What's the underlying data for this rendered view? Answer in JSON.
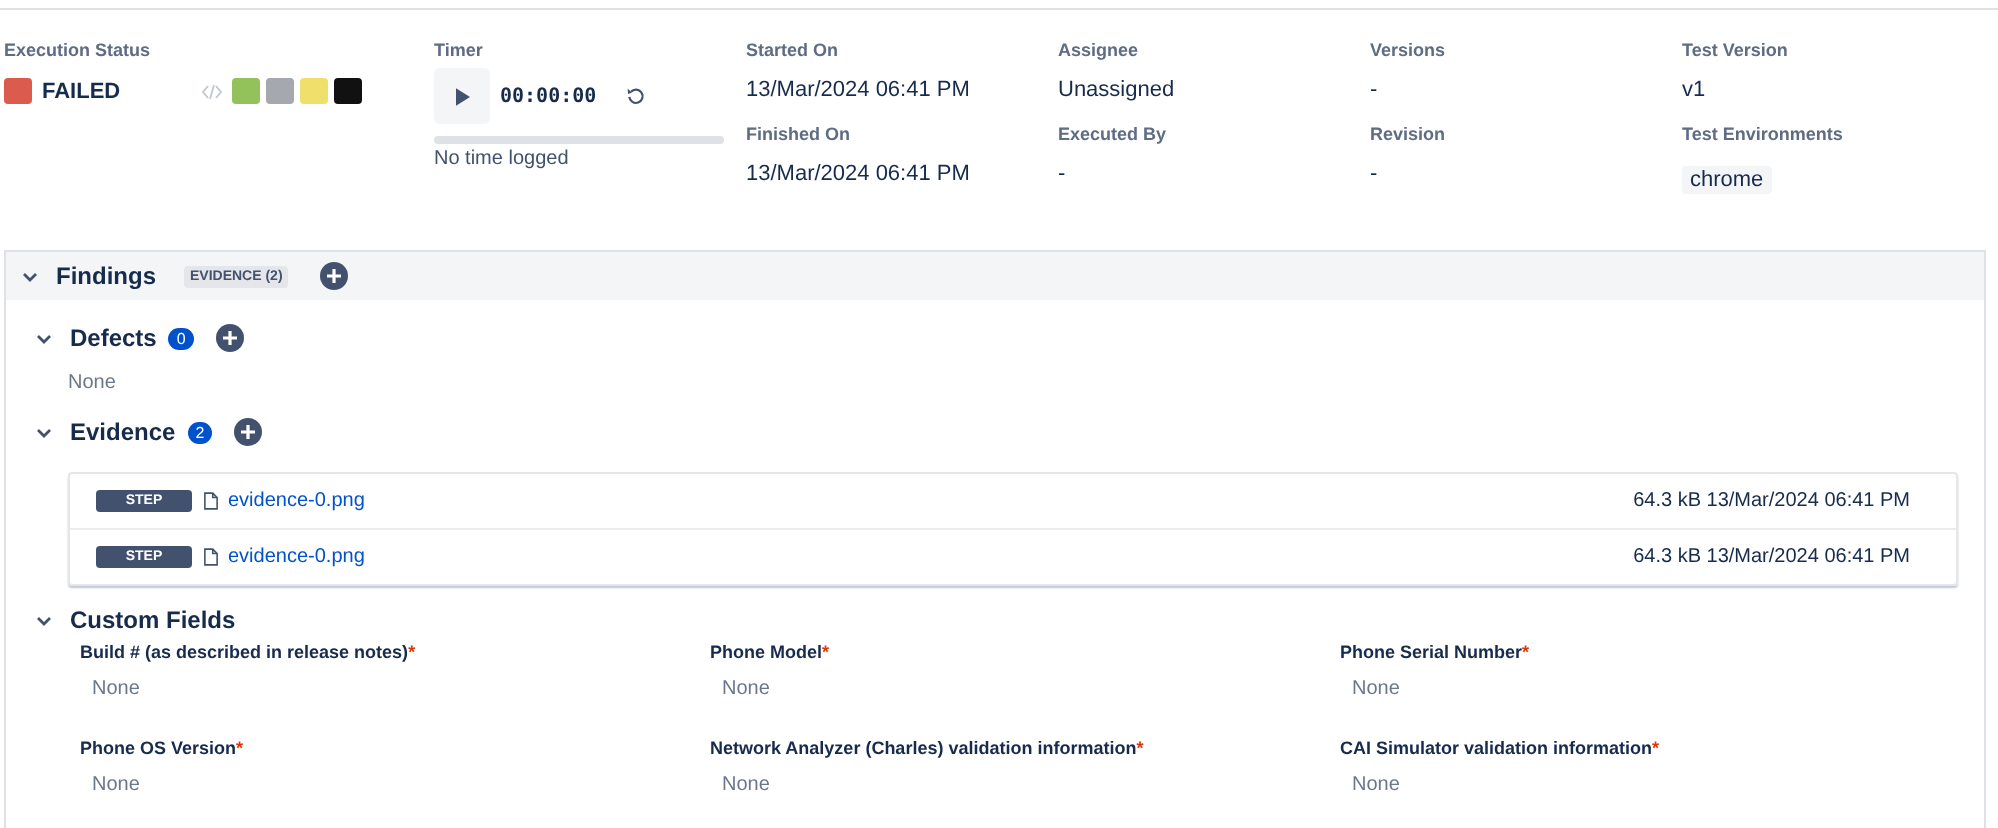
{
  "execution_status": {
    "label": "Execution Status",
    "value": "FAILED",
    "color": "#dc5b4f",
    "swatches": [
      {
        "color": "#94c25a"
      },
      {
        "color": "#a5a8ae"
      },
      {
        "color": "#f0df6a"
      },
      {
        "color": "#111111"
      }
    ]
  },
  "timer": {
    "label": "Timer",
    "time": "00:00:00",
    "level": 0,
    "note": "No time logged"
  },
  "fields": [
    {
      "label": "Started On",
      "value": "13/Mar/2024 06:41 PM",
      "kind": "text"
    },
    {
      "label": "Finished On",
      "value": "13/Mar/2024 06:41 PM",
      "kind": "text"
    },
    {
      "label": "Assignee",
      "value": "Unassigned",
      "kind": "text"
    },
    {
      "label": "Executed By",
      "value": "-",
      "kind": "text"
    },
    {
      "label": "Versions",
      "value": "-",
      "kind": "text"
    },
    {
      "label": "Revision",
      "value": "-",
      "kind": "text"
    },
    {
      "label": "Test Version",
      "value": "v1",
      "kind": "text"
    },
    {
      "label": "Test Environments",
      "value": "chrome",
      "kind": "tag"
    }
  ],
  "findings": {
    "title": "Findings",
    "expanded": true,
    "tag": "EVIDENCE (2)",
    "defects": {
      "title": "Defects",
      "count": "0",
      "expanded": true,
      "empty": "None"
    },
    "evidence": {
      "title": "Evidence",
      "count": "2",
      "expanded": true,
      "items": [
        {
          "tag": "STEP",
          "file": "evidence-0.png",
          "meta": "64.3 kB 13/Mar/2024 06:41 PM"
        },
        {
          "tag": "STEP",
          "file": "evidence-0.png",
          "meta": "64.3 kB 13/Mar/2024 06:41 PM"
        }
      ]
    },
    "custom_fields": {
      "title": "Custom Fields",
      "expanded": true,
      "items": [
        {
          "label": "Build # (as described in release notes)",
          "mark": "*",
          "value": "None"
        },
        {
          "label": "Phone Model",
          "mark": "*",
          "value": "None"
        },
        {
          "label": "Phone Serial Number",
          "mark": "*",
          "value": "None"
        },
        {
          "label": "Phone OS Version",
          "mark": "*",
          "value": "None"
        },
        {
          "label": "Network Analyzer (Charles) validation information",
          "mark": "*",
          "value": "None"
        },
        {
          "label": "CAI Simulator validation information",
          "mark": "*",
          "value": "None"
        }
      ]
    }
  }
}
